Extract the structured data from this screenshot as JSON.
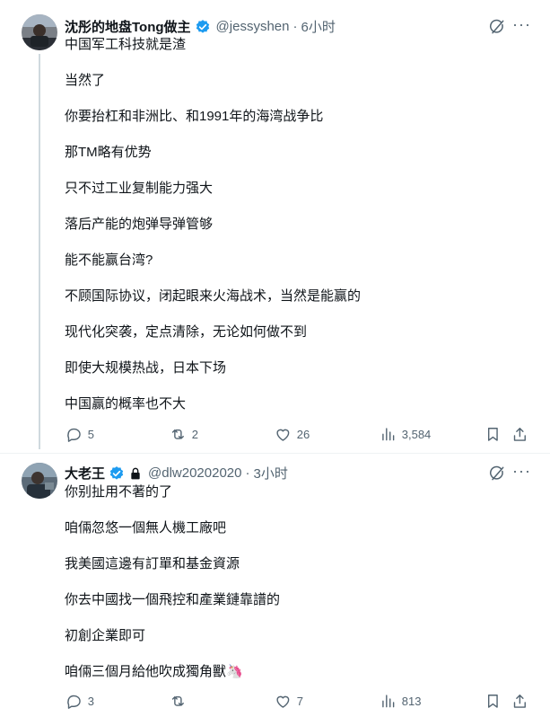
{
  "tweets": [
    {
      "author_name": "沈彤的地盘Tong做主",
      "handle": "@jessyshen",
      "dot": "·",
      "time": "6小时",
      "verified": true,
      "paragraphs": [
        "中国军工科技就是渣",
        "当然了",
        "你要抬杠和非洲比、和1991年的海湾战争比",
        "那TM略有优势",
        "只不过工业复制能力强大",
        "落后产能的炮弹导弹管够",
        "能不能赢台湾?",
        "不顾国际协议，闭起眼来火海战术，当然是能赢的",
        "现代化突袭，定点清除，无论如何做不到",
        "即使大规模热战，日本下场",
        "中国赢的概率也不大"
      ],
      "stats": {
        "replies": "5",
        "retweets": "2",
        "likes": "26",
        "views": "3,584"
      }
    },
    {
      "author_name": "大老王",
      "handle": "@dlw20202020",
      "dot": "·",
      "time": "3小时",
      "verified": true,
      "protected": true,
      "paragraphs": [
        "你别扯用不著的了",
        "咱倆忽悠一個無人機工廠吧",
        "我美國這邊有訂單和基金資源",
        "你去中國找一個飛控和產業鏈靠譜的",
        "初創企業即可",
        "咱倆三個月給他吹成獨角獸🦄"
      ],
      "stats": {
        "replies": "3",
        "retweets": "",
        "likes": "7",
        "views": "813"
      }
    }
  ],
  "colors": {
    "verified": "#1d9bf0",
    "muted": "#536471",
    "text": "#0f1419",
    "thread_line": "#cfd9de"
  },
  "icons": [
    "grok-icon",
    "more-icon",
    "reply-icon",
    "retweet-icon",
    "like-icon",
    "views-icon",
    "bookmark-icon",
    "share-icon",
    "verified-badge-icon",
    "lock-icon"
  ]
}
